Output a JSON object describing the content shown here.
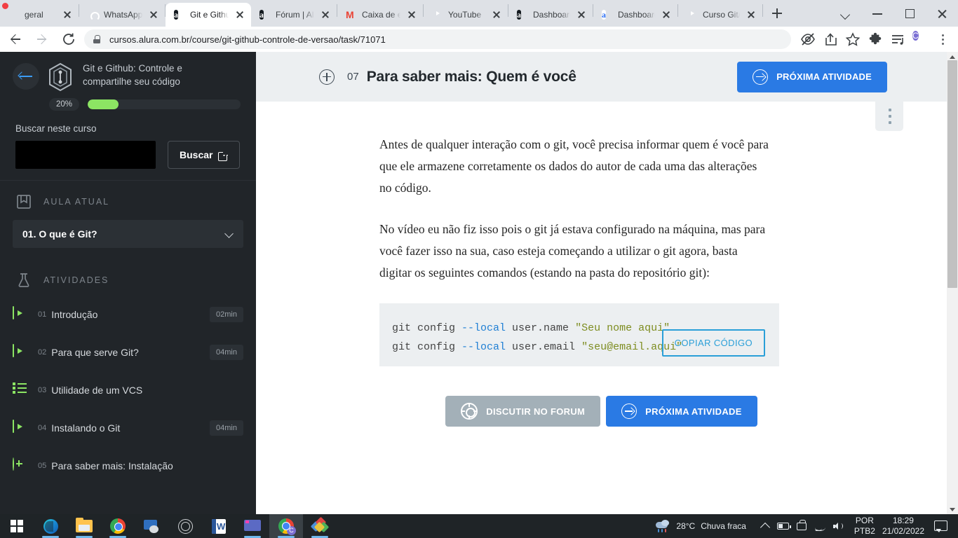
{
  "browser": {
    "tabs": [
      {
        "title": "geral",
        "favicon": "discord-icon",
        "active": false
      },
      {
        "title": "WhatsApp",
        "favicon": "whatsapp-icon",
        "active": false
      },
      {
        "title": "Git e Githu",
        "favicon": "alura-icon",
        "active": true
      },
      {
        "title": "Fórum | Al",
        "favicon": "alura-icon",
        "active": false
      },
      {
        "title": "Caixa de e",
        "favicon": "gmail-icon",
        "active": false
      },
      {
        "title": "YouTube",
        "favicon": "youtube-icon",
        "active": false
      },
      {
        "title": "Dashboard",
        "favicon": "alura-icon",
        "active": false
      },
      {
        "title": "Dashboard",
        "favicon": "alura-light-icon",
        "active": false
      },
      {
        "title": "Curso Git/(",
        "favicon": "youtube-icon",
        "active": false
      }
    ],
    "new_tab_label": "+",
    "url": "cursos.alura.com.br/course/git-github-controle-de-versao/task/71071",
    "profile_initial": "C",
    "window_controls": {
      "chevron": "chevron-down-icon",
      "minimize": "minimize-icon",
      "maximize": "maximize-icon",
      "close": "close-icon"
    }
  },
  "sidebar": {
    "course_title": "Git e Github: Controle e compartilhe seu código",
    "progress_percent": "20%",
    "progress_value": 20,
    "search_label": "Buscar neste curso",
    "search_value": "",
    "search_placeholder": "",
    "search_button": "Buscar",
    "current_lesson_section": "AULA ATUAL",
    "current_lesson": "01. O que é Git?",
    "activities_section": "ATIVIDADES",
    "activities": [
      {
        "num": "01",
        "label": "Introdução",
        "duration": "02min",
        "icon": "video-icon"
      },
      {
        "num": "02",
        "label": "Para que serve Git?",
        "duration": "04min",
        "icon": "video-icon"
      },
      {
        "num": "03",
        "label": "Utilidade de um VCS",
        "duration": "",
        "icon": "list-icon"
      },
      {
        "num": "04",
        "label": "Instalando o Git",
        "duration": "04min",
        "icon": "video-icon"
      },
      {
        "num": "05",
        "label": "Para saber mais: Instalação",
        "duration": "",
        "icon": "plus-circle-icon"
      }
    ]
  },
  "content": {
    "task_number": "07",
    "task_title": "Para saber mais: Quem é você",
    "next_activity_label": "PRÓXIMA ATIVIDADE",
    "paragraphs": [
      "Antes de qualquer interação com o git, você precisa informar quem é você para que ele armazene corretamente os dados do autor de cada uma das alterações no código.",
      "No vídeo eu não fiz isso pois o git já estava configurado na máquina, mas para você fazer isso na sua, caso esteja começando a utilizar o git agora, basta digitar os seguintes comandos (estando na pasta do repositório git):"
    ],
    "code": {
      "line1": {
        "cmd": "git config ",
        "flag": "--local",
        "mid": " user.name ",
        "str": "\"Seu nome aqui\""
      },
      "line2": {
        "cmd": "git config ",
        "flag": "--local",
        "mid": " user.email ",
        "str": "\"seu@email.aqui\""
      }
    },
    "copy_code_label": "COPIAR CÓDIGO",
    "discuss_label": "DISCUTIR NO FORUM",
    "next_activity_bottom_label": "PRÓXIMA ATIVIDADE"
  },
  "taskbar": {
    "apps": [
      {
        "name": "start-button",
        "icon": "windows-logo-icon"
      },
      {
        "name": "edge",
        "icon": "edge-icon"
      },
      {
        "name": "file-explorer",
        "icon": "folder-icon"
      },
      {
        "name": "chrome",
        "icon": "chrome-icon"
      },
      {
        "name": "remote-desktop",
        "icon": "remote-desktop-icon"
      },
      {
        "name": "obs",
        "icon": "obs-icon"
      },
      {
        "name": "word",
        "icon": "word-icon"
      },
      {
        "name": "monitor-app",
        "icon": "monitor-icon"
      },
      {
        "name": "chrome-profile",
        "icon": "chrome-profile-icon"
      },
      {
        "name": "diamonds-app",
        "icon": "diamonds-icon"
      }
    ],
    "weather_temp": "28°C",
    "weather_desc": "Chuva fraca",
    "lang_line1": "POR",
    "lang_line2": "PTB2",
    "time": "18:29",
    "date": "21/02/2022"
  },
  "colors": {
    "accent_blue": "#2a7ae4",
    "sidebar_bg": "#212529",
    "progress_green": "#8ce563",
    "header_bg": "#eceff1"
  }
}
